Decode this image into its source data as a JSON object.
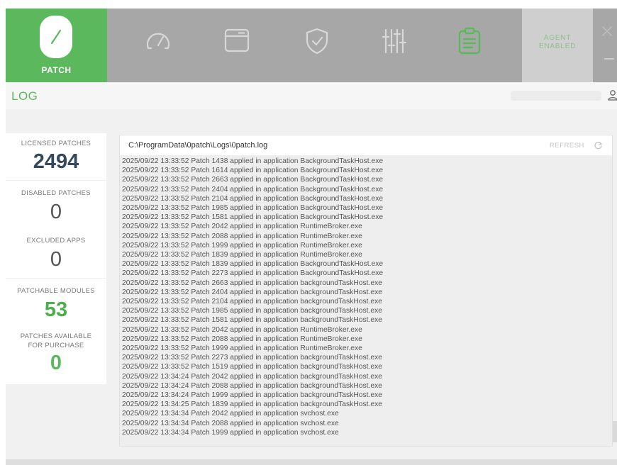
{
  "brand": {
    "label": "PATCH"
  },
  "nav": {
    "items": [
      {
        "icon": "gauge-icon"
      },
      {
        "icon": "window-icon"
      },
      {
        "icon": "shield-icon"
      },
      {
        "icon": "sliders-icon"
      },
      {
        "icon": "clipboard-icon",
        "active": true
      }
    ]
  },
  "agent": {
    "line1": "AGENT",
    "line2": "ENABLED"
  },
  "page": {
    "title": "LOG"
  },
  "stats": {
    "licensed_label": "LICENSED PATCHES",
    "licensed_value": "2494",
    "disabled_label": "DISABLED PATCHES",
    "disabled_value": "0",
    "excluded_label": "EXCLUDED APPS",
    "excluded_value": "0",
    "patchable_label": "PATCHABLE MODULES",
    "patchable_value": "53",
    "available_label_1": "PATCHES AVAILABLE",
    "available_label_2": "FOR PURCHASE",
    "available_value": "0"
  },
  "log": {
    "path": "C:\\ProgramData\\0patch\\Logs\\0patch.log",
    "refresh_label": "REFRESH",
    "lines": [
      "2025/09/22 13:33:52 Patch 1438 applied in application BackgroundTaskHost.exe",
      "2025/09/22 13:33:52 Patch 1614 applied in application BackgroundTaskHost.exe",
      "2025/09/22 13:33:52 Patch 2663 applied in application BackgroundTaskHost.exe",
      "2025/09/22 13:33:52 Patch 2404 applied in application BackgroundTaskHost.exe",
      "2025/09/22 13:33:52 Patch 2104 applied in application BackgroundTaskHost.exe",
      "2025/09/22 13:33:52 Patch 1985 applied in application BackgroundTaskHost.exe",
      "2025/09/22 13:33:52 Patch 1581 applied in application BackgroundTaskHost.exe",
      "2025/09/22 13:33:52 Patch 2042 applied in application RuntimeBroker.exe",
      "2025/09/22 13:33:52 Patch 2088 applied in application RuntimeBroker.exe",
      "2025/09/22 13:33:52 Patch 1999 applied in application RuntimeBroker.exe",
      "2025/09/22 13:33:52 Patch 1839 applied in application RuntimeBroker.exe",
      "2025/09/22 13:33:52 Patch 1839 applied in application BackgroundTaskHost.exe",
      "2025/09/22 13:33:52 Patch 2273 applied in application BackgroundTaskHost.exe",
      "2025/09/22 13:33:52 Patch 2663 applied in application backgroundTaskHost.exe",
      "2025/09/22 13:33:52 Patch 2404 applied in application backgroundTaskHost.exe",
      "2025/09/22 13:33:52 Patch 2104 applied in application backgroundTaskHost.exe",
      "2025/09/22 13:33:52 Patch 1985 applied in application backgroundTaskHost.exe",
      "2025/09/22 13:33:52 Patch 1581 applied in application backgroundTaskHost.exe",
      "2025/09/22 13:33:52 Patch 2042 applied in application RuntimeBroker.exe",
      "2025/09/22 13:33:52 Patch 2088 applied in application RuntimeBroker.exe",
      "2025/09/22 13:33:52 Patch 1999 applied in application RuntimeBroker.exe",
      "2025/09/22 13:33:52 Patch 2273 applied in application backgroundTaskHost.exe",
      "2025/09/22 13:33:52 Patch 1519 applied in application backgroundTaskHost.exe",
      "2025/09/22 13:34:24 Patch 2042 applied in application backgroundTaskHost.exe",
      "2025/09/22 13:34:24 Patch 2088 applied in application backgroundTaskHost.exe",
      "2025/09/22 13:34:24 Patch 1999 applied in application backgroundTaskHost.exe",
      "2025/09/22 13:34:25 Patch 1839 applied in application backgroundTaskHost.exe",
      "2025/09/22 13:34:34 Patch 2042 applied in application svchost.exe",
      "2025/09/22 13:34:34 Patch 2088 applied in application svchost.exe",
      "2025/09/22 13:34:34 Patch 1999 applied in application svchost.exe"
    ]
  },
  "colors": {
    "accent": "#5cb85c",
    "topbar": "#a7a7a7",
    "licensed_value": "#34495e",
    "disabled_value": "#555555",
    "patchable_value": "#4cae4c"
  }
}
